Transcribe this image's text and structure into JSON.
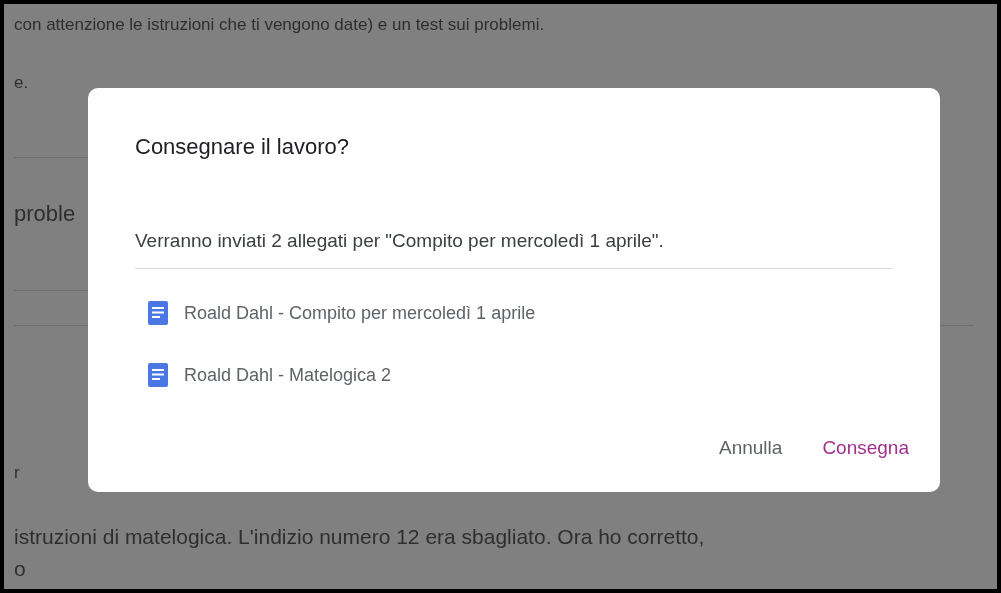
{
  "background_page": {
    "intro_line": "con attenzione le istruzioni che ti vengono date) e un test sui problemi.",
    "intro_end": "e.",
    "section_heading": "proble",
    "comment_label": "r",
    "comment_text": "istruzioni di matelogica. L'indizio numero 12 era sbagliato. Ora ho corretto,",
    "comment_end": "o"
  },
  "dialog": {
    "title": "Consegnare il lavoro?",
    "message": "Verranno inviati 2 allegati per \"Compito per mercoledì 1 aprile\".",
    "attachments": [
      {
        "name": "Roald Dahl - Compito per mercoledì 1 aprile"
      },
      {
        "name": "Roald Dahl - Matelogica 2"
      }
    ],
    "buttons": [
      {
        "label": "Annulla",
        "kind": "cancel"
      },
      {
        "label": "Consegna",
        "kind": "confirm"
      }
    ]
  }
}
